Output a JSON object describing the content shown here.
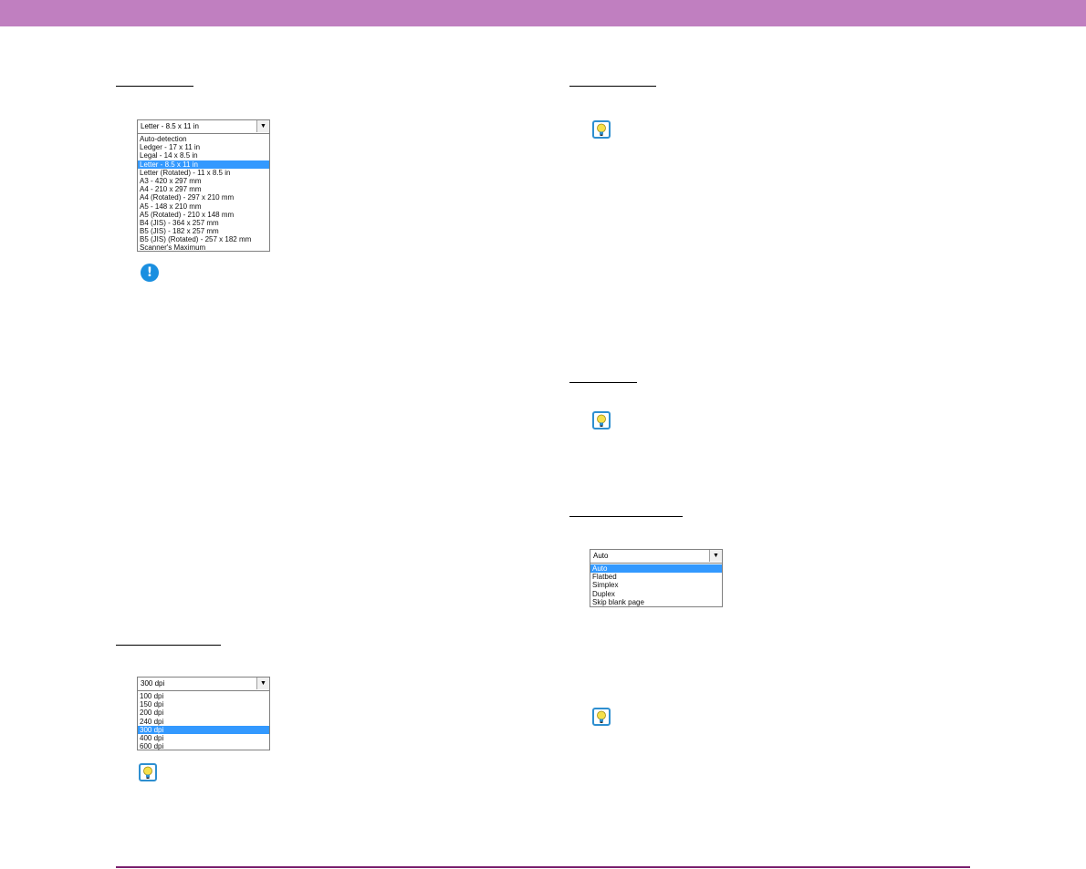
{
  "colors": {
    "header_bar": "#c07fc0",
    "footer_rule": "#7a1f6e",
    "selection": "#3399ff",
    "important_icon": "#1a8fe0",
    "hint_icon_border": "#2e8fd0",
    "hint_bulb": "#f5e04a"
  },
  "icons": {
    "important": "exclamation-icon",
    "hint": "lightbulb-icon"
  },
  "page_size_dropdown": {
    "selected_value": "Letter - 8.5 x 11 in",
    "selected_index": 3,
    "options": [
      "Auto-detection",
      "Ledger - 17 x 11 in",
      "Legal - 14 x 8.5 in",
      "Letter - 8.5 x 11 in",
      "Letter (Rotated) - 11 x 8.5 in",
      "A3 - 420 x 297 mm",
      "A4 - 210 x 297 mm",
      "A4 (Rotated) - 297 x 210 mm",
      "A5 - 148 x 210 mm",
      "A5 (Rotated) - 210 x 148 mm",
      "B4 (JIS) - 364 x 257 mm",
      "B5 (JIS) - 182 x 257 mm",
      "B5 (JIS) (Rotated) - 257 x 182 mm",
      "Scanner's Maximum"
    ]
  },
  "resolution_dropdown": {
    "selected_value": "300 dpi",
    "selected_index": 4,
    "options": [
      "100 dpi",
      "150 dpi",
      "200 dpi",
      "240 dpi",
      "300 dpi",
      "400 dpi",
      "600 dpi"
    ]
  },
  "scanning_side_dropdown": {
    "selected_value": "Auto",
    "selected_index": 0,
    "options": [
      "Auto",
      "Flatbed",
      "Simplex",
      "Duplex",
      "Skip blank page"
    ]
  }
}
